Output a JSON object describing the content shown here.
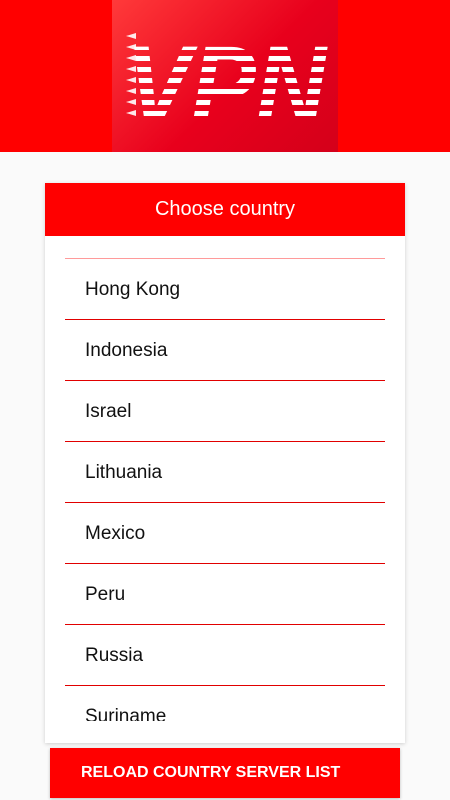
{
  "logo": {
    "text": "VPN",
    "background_color": "#ff0000"
  },
  "dialog": {
    "title": "Choose country",
    "countries": [
      "Hong Kong",
      "Indonesia",
      "Israel",
      "Lithuania",
      "Mexico",
      "Peru",
      "Russia",
      "Suriname"
    ]
  },
  "actions": {
    "reload_label": "RELOAD COUNTRY SERVER LIST"
  },
  "colors": {
    "accent": "#ff0000",
    "divider": "#e10000"
  }
}
